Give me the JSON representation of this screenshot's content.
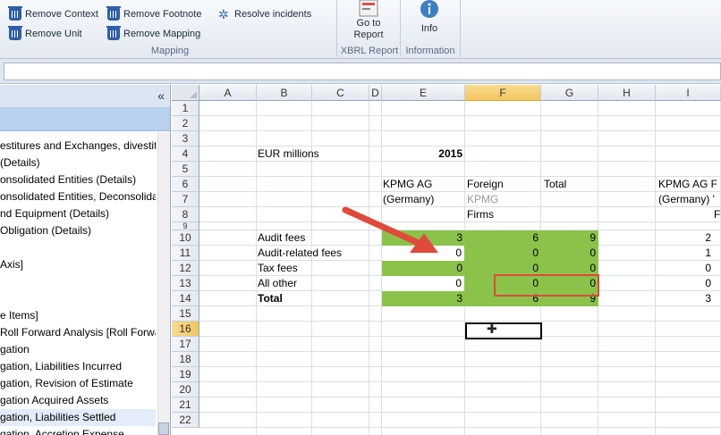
{
  "ribbon": {
    "items": [
      {
        "label": "Remove Context",
        "icon": "trash-icon"
      },
      {
        "label": "Remove Unit",
        "icon": "trash-icon"
      },
      {
        "label": "Remove Footnote",
        "icon": "trash-icon"
      },
      {
        "label": "Remove Mapping",
        "icon": "trash-icon"
      },
      {
        "label": "Resolve incidents",
        "icon": "gear-icon"
      }
    ],
    "group_mapping": "Mapping",
    "goto_report": "Go to Report",
    "group_xbrl": "XBRL Report",
    "info": "Info",
    "group_info": "Information"
  },
  "sidebar": {
    "collapse_glyph": "«",
    "items": [
      "estitures and Exchanges, divestiture",
      "(Details)",
      "onsolidated Entities (Details)",
      "onsolidated Entities, Deconsolidati",
      "nd Equipment (Details)",
      " Obligation (Details)",
      "",
      "Axis]",
      "",
      "",
      "e Items]",
      "Roll Forward Analysis [Roll Forward",
      "gation",
      "gation, Liabilities Incurred",
      "gation, Revision of Estimate",
      "gation Acquired Assets",
      "gation, Liabilities Settled",
      "gation, Accretion Expense"
    ]
  },
  "sheet": {
    "columns": [
      "A",
      "B",
      "C",
      "D",
      "E",
      "F",
      "G",
      "H",
      "I"
    ],
    "active_column": "F",
    "rows": [
      "1",
      "2",
      "3",
      "4",
      "5",
      "6",
      "7",
      "8",
      "9",
      "10",
      "11",
      "12",
      "13",
      "14",
      "15",
      "16",
      "17",
      "18",
      "19",
      "20",
      "21",
      "22"
    ],
    "active_row": "16",
    "eur_millions": "EUR millions",
    "year": "2015",
    "e6": "KPMG AG",
    "e7": "(Germany)",
    "f6": "Foreign",
    "f7": "KPMG",
    "f8": "Firms",
    "g6": "Total",
    "i6": "KPMG AG F",
    "i7": "(Germany) '",
    "i8": "F",
    "table_rows": [
      {
        "label": "Audit fees",
        "e": "3",
        "f": "6",
        "g": "9",
        "i": "2"
      },
      {
        "label": "Audit-related fees",
        "e": "0",
        "f": "0",
        "g": "0",
        "i": "1"
      },
      {
        "label": "Tax fees",
        "e": "0",
        "f": "0",
        "g": "0",
        "i": "0"
      },
      {
        "label": "All other",
        "e": "0",
        "f": "0",
        "g": "0",
        "i": "0"
      },
      {
        "label": "Total",
        "e": "3",
        "f": "6",
        "g": "9",
        "i": "3"
      }
    ]
  },
  "colors": {
    "green_fill": "#8bc34a",
    "annotation_red": "#e04a3c",
    "active_header": "#f2c55f"
  }
}
